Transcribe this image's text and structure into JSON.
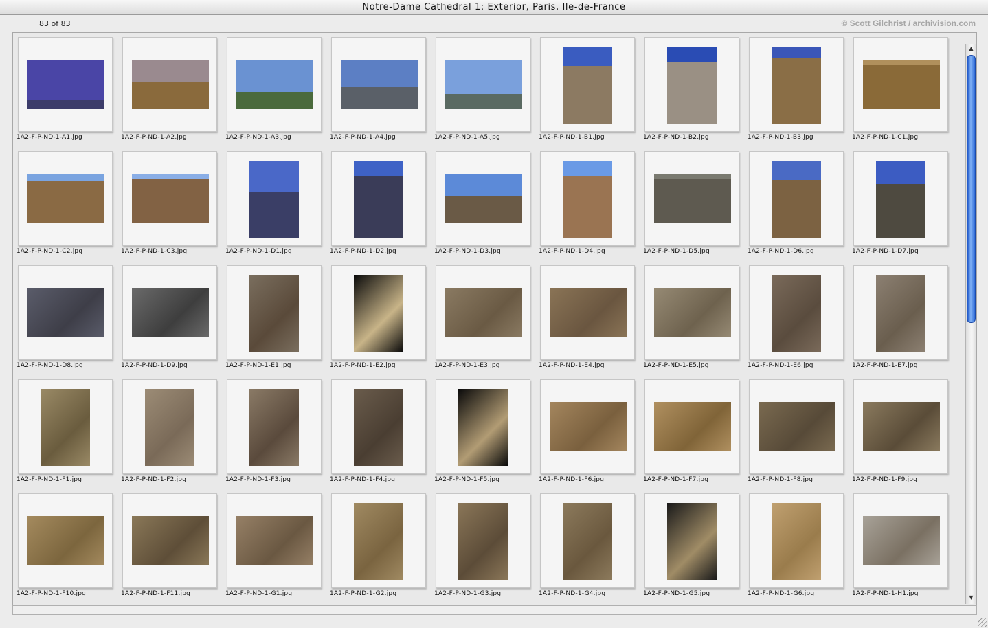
{
  "window": {
    "title": "Notre-Dame Cathedral 1: Exterior, Paris, Ile-de-France",
    "count": "83 of 83",
    "copyright": "© Scott Gilchrist / archivision.com"
  },
  "colors": {
    "accent": "#2e6ad6",
    "frame": "#f5f5f5"
  },
  "thumbnails": [
    {
      "filename": "1A2-F-P-ND-1-A1.jpg",
      "orientation": "land",
      "sky": "#4a45a6",
      "stone": "#3c3c6a",
      "stone_pct": 18
    },
    {
      "filename": "1A2-F-P-ND-1-A2.jpg",
      "orientation": "land",
      "sky": "#9a8a8f",
      "stone": "#8a6a3c",
      "stone_pct": 55
    },
    {
      "filename": "1A2-F-P-ND-1-A3.jpg",
      "orientation": "land",
      "sky": "#6a92d2",
      "stone": "#4a6a3c",
      "stone_pct": 35
    },
    {
      "filename": "1A2-F-P-ND-1-A4.jpg",
      "orientation": "land",
      "sky": "#5c7fc4",
      "stone": "#5a6068",
      "stone_pct": 45
    },
    {
      "filename": "1A2-F-P-ND-1-A5.jpg",
      "orientation": "land",
      "sky": "#7aa0dc",
      "stone": "#5a6a62",
      "stone_pct": 30
    },
    {
      "filename": "1A2-F-P-ND-1-B1.jpg",
      "orientation": "port",
      "sky": "#3a5cc0",
      "stone": "#8c7a62",
      "stone_pct": 75
    },
    {
      "filename": "1A2-F-P-ND-1-B2.jpg",
      "orientation": "port",
      "sky": "#2a4cb4",
      "stone": "#9a9084",
      "stone_pct": 80
    },
    {
      "filename": "1A2-F-P-ND-1-B3.jpg",
      "orientation": "port",
      "sky": "#3a56b8",
      "stone": "#8a6e46",
      "stone_pct": 85
    },
    {
      "filename": "1A2-F-P-ND-1-C1.jpg",
      "orientation": "land",
      "sky": "#b0905c",
      "stone": "#8a6a38",
      "stone_pct": 90
    },
    {
      "filename": "1A2-F-P-ND-1-C2.jpg",
      "orientation": "land",
      "sky": "#7aa4e0",
      "stone": "#8a6a44",
      "stone_pct": 85
    },
    {
      "filename": "1A2-F-P-ND-1-C3.jpg",
      "orientation": "land",
      "sky": "#8aaee6",
      "stone": "#826244",
      "stone_pct": 90
    },
    {
      "filename": "1A2-F-P-ND-1-D1.jpg",
      "orientation": "port",
      "sky": "#4a68c8",
      "stone": "#3a3e66",
      "stone_pct": 60
    },
    {
      "filename": "1A2-F-P-ND-1-D2.jpg",
      "orientation": "port",
      "sky": "#3e62c6",
      "stone": "#3a3c58",
      "stone_pct": 80
    },
    {
      "filename": "1A2-F-P-ND-1-D3.jpg",
      "orientation": "land",
      "sky": "#5c8ad8",
      "stone": "#6a5a46",
      "stone_pct": 55
    },
    {
      "filename": "1A2-F-P-ND-1-D4.jpg",
      "orientation": "port",
      "sky": "#6a9ae6",
      "stone": "#9a7452",
      "stone_pct": 80
    },
    {
      "filename": "1A2-F-P-ND-1-D5.jpg",
      "orientation": "land",
      "sky": "#7a7a70",
      "stone": "#5e5a50",
      "stone_pct": 90
    },
    {
      "filename": "1A2-F-P-ND-1-D6.jpg",
      "orientation": "port",
      "sky": "#4a6ac4",
      "stone": "#7c6242",
      "stone_pct": 75
    },
    {
      "filename": "1A2-F-P-ND-1-D7.jpg",
      "orientation": "port",
      "sky": "#3c5cc2",
      "stone": "#4e4a40",
      "stone_pct": 70
    },
    {
      "filename": "1A2-F-P-ND-1-D8.jpg",
      "orientation": "land",
      "sky": "#5a5c6a",
      "stone": "#3e3e48",
      "stone_pct": 100
    },
    {
      "filename": "1A2-F-P-ND-1-D9.jpg",
      "orientation": "land",
      "sky": "#6a6a6a",
      "stone": "#3e3e3e",
      "stone_pct": 100
    },
    {
      "filename": "1A2-F-P-ND-1-E1.jpg",
      "orientation": "port",
      "sky": "#7a6e5e",
      "stone": "#5a4a3a",
      "stone_pct": 100
    },
    {
      "filename": "1A2-F-P-ND-1-E2.jpg",
      "orientation": "port",
      "sky": "#0a0a0a",
      "stone": "#c8b488",
      "stone_pct": 100
    },
    {
      "filename": "1A2-F-P-ND-1-E3.jpg",
      "orientation": "land",
      "sky": "#8a7a62",
      "stone": "#6a5a44",
      "stone_pct": 100
    },
    {
      "filename": "1A2-F-P-ND-1-E4.jpg",
      "orientation": "land",
      "sky": "#8a7456",
      "stone": "#6a5640",
      "stone_pct": 100
    },
    {
      "filename": "1A2-F-P-ND-1-E5.jpg",
      "orientation": "land",
      "sky": "#968a74",
      "stone": "#6e624e",
      "stone_pct": 100
    },
    {
      "filename": "1A2-F-P-ND-1-E6.jpg",
      "orientation": "port",
      "sky": "#7a6a5a",
      "stone": "#5a4c3e",
      "stone_pct": 100
    },
    {
      "filename": "1A2-F-P-ND-1-E7.jpg",
      "orientation": "port",
      "sky": "#8c8072",
      "stone": "#6a5e4e",
      "stone_pct": 100
    },
    {
      "filename": "1A2-F-P-ND-1-F1.jpg",
      "orientation": "port",
      "sky": "#9a8a66",
      "stone": "#6a5c3e",
      "stone_pct": 100
    },
    {
      "filename": "1A2-F-P-ND-1-F2.jpg",
      "orientation": "port",
      "sky": "#9c8c76",
      "stone": "#7a6a58",
      "stone_pct": 100
    },
    {
      "filename": "1A2-F-P-ND-1-F3.jpg",
      "orientation": "port",
      "sky": "#8a7a66",
      "stone": "#5a4a3c",
      "stone_pct": 100
    },
    {
      "filename": "1A2-F-P-ND-1-F4.jpg",
      "orientation": "port",
      "sky": "#6a5c4c",
      "stone": "#4a3e32",
      "stone_pct": 100
    },
    {
      "filename": "1A2-F-P-ND-1-F5.jpg",
      "orientation": "port",
      "sky": "#0a0a0a",
      "stone": "#b29c74",
      "stone_pct": 100
    },
    {
      "filename": "1A2-F-P-ND-1-F6.jpg",
      "orientation": "land",
      "sky": "#a4865e",
      "stone": "#7a603e",
      "stone_pct": 100
    },
    {
      "filename": "1A2-F-P-ND-1-F7.jpg",
      "orientation": "land",
      "sky": "#b09060",
      "stone": "#806438",
      "stone_pct": 100
    },
    {
      "filename": "1A2-F-P-ND-1-F8.jpg",
      "orientation": "land",
      "sky": "#7a6a50",
      "stone": "#574a38",
      "stone_pct": 100
    },
    {
      "filename": "1A2-F-P-ND-1-F9.jpg",
      "orientation": "land",
      "sky": "#8a7a5e",
      "stone": "#5a4c38",
      "stone_pct": 100
    },
    {
      "filename": "1A2-F-P-ND-1-F10.jpg",
      "orientation": "land",
      "sky": "#a48a5e",
      "stone": "#7c663e",
      "stone_pct": 100
    },
    {
      "filename": "1A2-F-P-ND-1-F11.jpg",
      "orientation": "land",
      "sky": "#8a7858",
      "stone": "#5e4e38",
      "stone_pct": 100
    },
    {
      "filename": "1A2-F-P-ND-1-G1.jpg",
      "orientation": "land",
      "sky": "#968066",
      "stone": "#6a5842",
      "stone_pct": 100
    },
    {
      "filename": "1A2-F-P-ND-1-G2.jpg",
      "orientation": "port",
      "sky": "#a08a62",
      "stone": "#7a6440",
      "stone_pct": 100
    },
    {
      "filename": "1A2-F-P-ND-1-G3.jpg",
      "orientation": "port",
      "sky": "#8a7658",
      "stone": "#5c4c38",
      "stone_pct": 100
    },
    {
      "filename": "1A2-F-P-ND-1-G4.jpg",
      "orientation": "port",
      "sky": "#8c7a5c",
      "stone": "#6a583e",
      "stone_pct": 100
    },
    {
      "filename": "1A2-F-P-ND-1-G5.jpg",
      "orientation": "port",
      "sky": "#1a1a1a",
      "stone": "#a08c66",
      "stone_pct": 100
    },
    {
      "filename": "1A2-F-P-ND-1-G6.jpg",
      "orientation": "port",
      "sky": "#c0a070",
      "stone": "#9a7c4c",
      "stone_pct": 100
    },
    {
      "filename": "1A2-F-P-ND-1-H1.jpg",
      "orientation": "land",
      "sky": "#a8a298",
      "stone": "#7a7062",
      "stone_pct": 100
    }
  ]
}
